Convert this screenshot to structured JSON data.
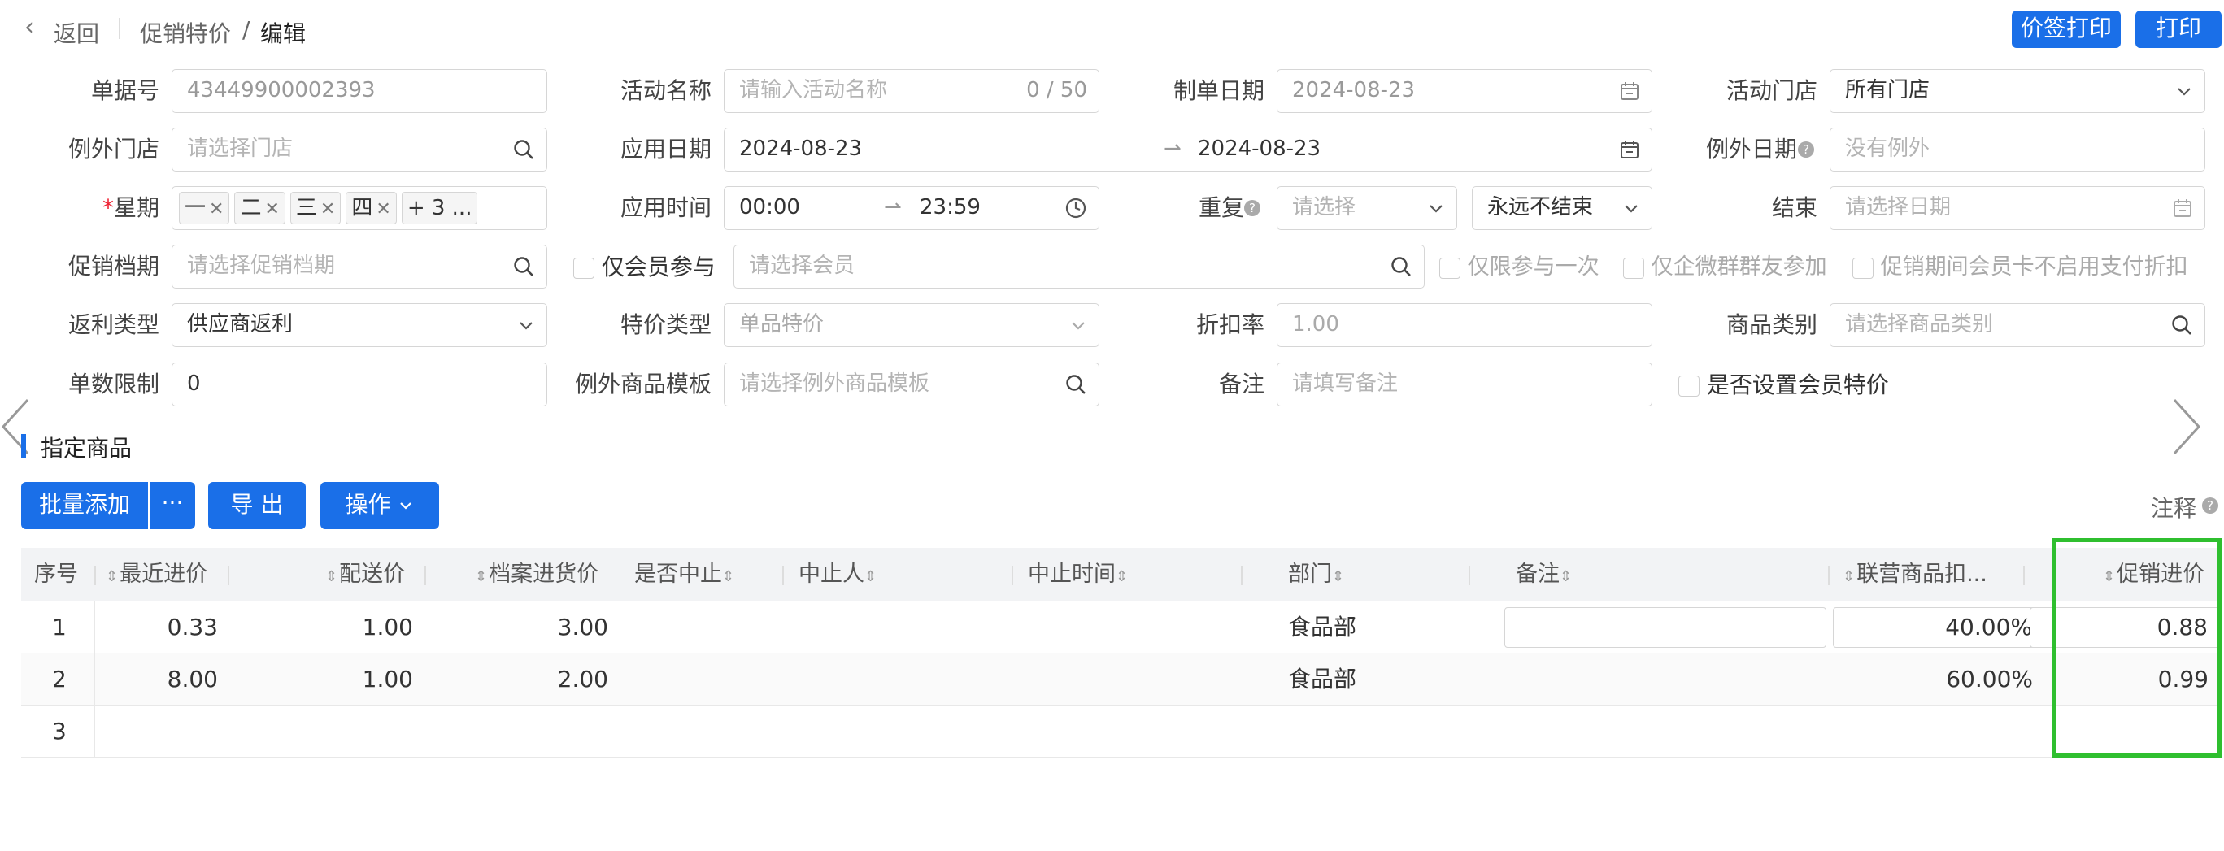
{
  "header": {
    "back_label": "返回",
    "breadcrumb": [
      "促销特价",
      "/",
      "编辑"
    ],
    "price_tag_print_label": "价签打印",
    "print_label": "打印"
  },
  "form": {
    "doc_no": {
      "label": "单据号",
      "value": "43449900002393"
    },
    "activity_name": {
      "label": "活动名称",
      "placeholder": "请输入活动名称",
      "counter": "0 / 50"
    },
    "create_date": {
      "label": "制单日期",
      "value": "2024-08-23"
    },
    "activity_store": {
      "label": "活动门店",
      "value": "所有门店"
    },
    "exception_store": {
      "label": "例外门店",
      "placeholder": "请选择门店"
    },
    "apply_date": {
      "label": "应用日期",
      "start": "2024-08-23",
      "end": "2024-08-23"
    },
    "exception_date": {
      "label": "例外日期",
      "placeholder": "没有例外"
    },
    "weekday": {
      "required_mark": "*",
      "label": "星期",
      "tags": [
        "一",
        "二",
        "三",
        "四"
      ],
      "more": "+ 3 ..."
    },
    "apply_time": {
      "label": "应用时间",
      "start": "00:00",
      "end": "23:59"
    },
    "repeat": {
      "label": "重复",
      "placeholder": "请选择",
      "end_mode": "永远不结束"
    },
    "end": {
      "label": "结束",
      "placeholder": "请选择日期"
    },
    "promo_period": {
      "label": "促销档期",
      "placeholder": "请选择促销档期"
    },
    "member_only": {
      "label": "仅会员参与",
      "placeholder": "请选择会员"
    },
    "once_only": {
      "label": "仅限参与一次"
    },
    "wecom_only": {
      "label": "仅企微群群友参加"
    },
    "card_disabled": {
      "label": "促销期间会员卡不启用支付折扣"
    },
    "rebate_type": {
      "label": "返利类型",
      "value": "供应商返利"
    },
    "special_type": {
      "label": "特价类型",
      "value": "单品特价"
    },
    "discount_rate": {
      "label": "折扣率",
      "value": "1.00"
    },
    "goods_category": {
      "label": "商品类别",
      "placeholder": "请选择商品类别"
    },
    "order_limit": {
      "label": "单数限制",
      "value": "0"
    },
    "exception_template": {
      "label": "例外商品模板",
      "placeholder": "请选择例外商品模板"
    },
    "remark": {
      "label": "备注",
      "placeholder": "请填写备注"
    },
    "member_price": {
      "label": "是否设置会员特价"
    }
  },
  "section": {
    "title": "指定商品",
    "batch_add": "批量添加",
    "more": "···",
    "export": "导 出",
    "operate": "操作",
    "notes": "注释"
  },
  "table": {
    "headers": [
      "序号",
      "最近进价",
      "配送价",
      "档案进货价",
      "是否中止",
      "中止人",
      "中止时间",
      "部门",
      "备注",
      "联营商品扣...",
      "促销进价"
    ],
    "rows": [
      {
        "no": "1",
        "recent": "0.33",
        "delivery": "1.00",
        "archive": "3.00",
        "dept": "食品部",
        "rate": "40.00%",
        "promo": "0.88"
      },
      {
        "no": "2",
        "recent": "8.00",
        "delivery": "1.00",
        "archive": "2.00",
        "dept": "食品部",
        "rate": "60.00%",
        "promo": "0.99"
      },
      {
        "no": "3"
      }
    ]
  },
  "colors": {
    "accent": "#1a6fe8",
    "highlight": "#2fbf2f"
  }
}
